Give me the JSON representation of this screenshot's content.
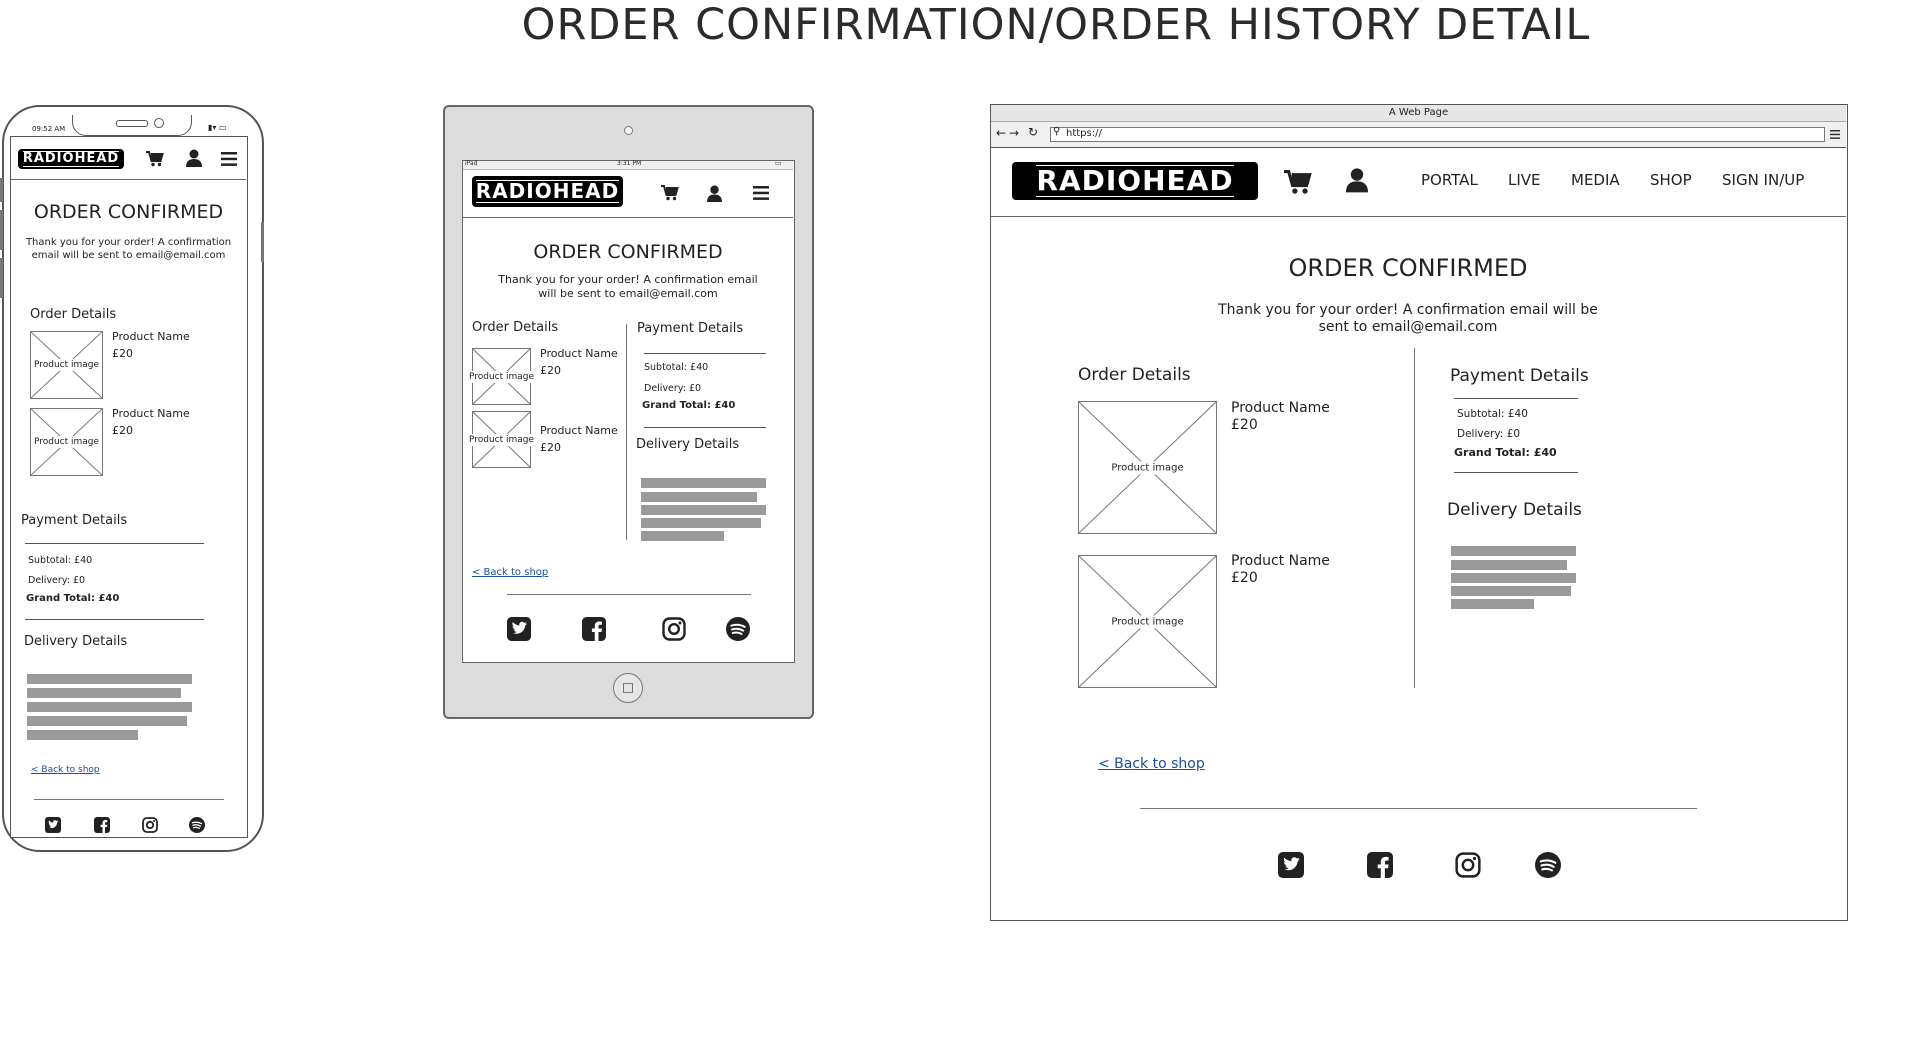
{
  "page": {
    "title": "ORDER CONFIRMATION/ORDER HISTORY DETAIL"
  },
  "brand": {
    "logo_text": "RADIOHEAD"
  },
  "phone": {
    "status_time": "09:52 AM",
    "heading": "ORDER CONFIRMED",
    "thanks_line1": "Thank you for your order! A confirmation",
    "thanks_line2": "email will be sent to email@email.com",
    "order_details_title": "Order Details",
    "payment_details_title": "Payment Details",
    "delivery_details_title": "Delivery Details"
  },
  "tablet": {
    "status_left": "iPad",
    "status_time": "3:31 PM",
    "heading": "ORDER CONFIRMED",
    "thanks_line1": "Thank you for your order! A confirmation email",
    "thanks_line2": "will be sent to email@email.com",
    "order_details_title": "Order Details",
    "payment_details_title": "Payment Details",
    "delivery_details_title": "Delivery Details"
  },
  "desktop": {
    "window_title": "A Web Page",
    "url": "https://",
    "nav": [
      "PORTAL",
      "LIVE",
      "MEDIA",
      "SHOP",
      "SIGN IN/UP"
    ],
    "heading": "ORDER CONFIRMED",
    "thanks_line1": "Thank you for your order! A confirmation email will be",
    "thanks_line2": "sent to email@email.com",
    "order_details_title": "Order Details",
    "payment_details_title": "Payment Details",
    "delivery_details_title": "Delivery Details"
  },
  "products": [
    {
      "image_label": "Product image",
      "name": "Product Name",
      "price": "£20"
    },
    {
      "image_label": "Product image",
      "name": "Product Name",
      "price": "£20"
    }
  ],
  "payment": {
    "subtotal": "Subtotal: £40",
    "delivery": "Delivery: £0",
    "grand_total": "Grand Total: £40"
  },
  "back_link": "< Back to shop",
  "icons": {
    "cart": "cart-icon",
    "account": "user-icon",
    "menu": "hamburger-menu-icon",
    "twitter": "twitter-icon",
    "facebook": "facebook-icon",
    "instagram": "instagram-icon",
    "spotify": "spotify-icon"
  },
  "colors": {
    "placeholder_bar": "#9a9a9a",
    "link": "#1a4fa0",
    "tablet_bezel": "#dcdcdc"
  }
}
